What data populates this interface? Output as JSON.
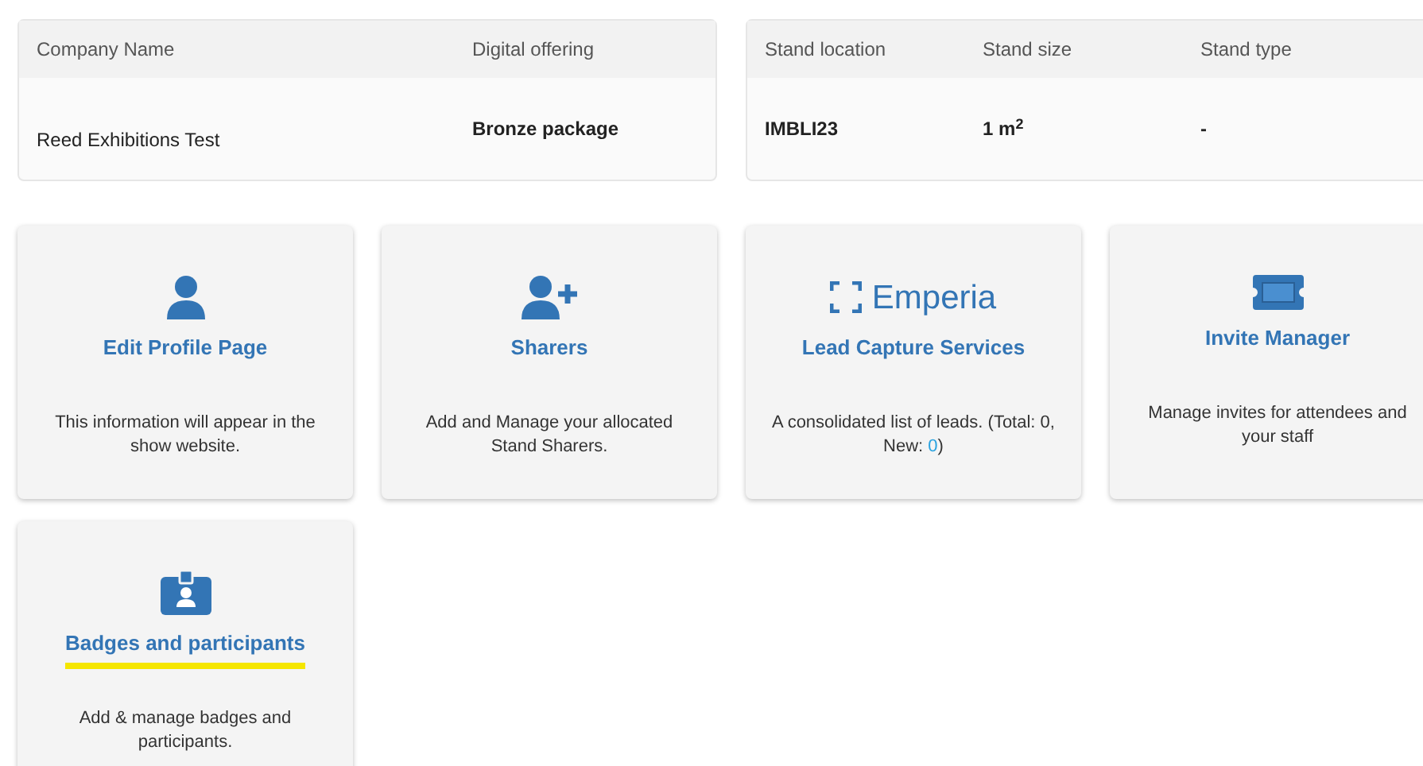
{
  "info_panels": [
    {
      "columns": [
        {
          "header": "Company Name",
          "value": "Reed Exhibitions Test",
          "bold": false
        },
        {
          "header": "Digital offering",
          "value": "Bronze package",
          "bold": true
        }
      ]
    },
    {
      "columns": [
        {
          "header": "Stand location",
          "value": "IMBLI23",
          "bold": true
        },
        {
          "header": "Stand size",
          "value": "1 m$^{2}$",
          "bold": true
        },
        {
          "header": "Stand type",
          "value": "-",
          "bold": true
        }
      ]
    }
  ],
  "cards": [
    {
      "kind": "person",
      "title": "Edit Profile Page",
      "description": [
        {
          "text": "This information will appear in the show website.",
          "highlight": false
        }
      ],
      "underlined": false
    },
    {
      "kind": "person-plus",
      "title": "Sharers",
      "description": [
        {
          "text": "Add and Manage your allocated Stand Sharers.",
          "highlight": false
        }
      ],
      "underlined": false
    },
    {
      "kind": "logo",
      "logo_text": "Emperia",
      "title": "Lead Capture Services",
      "description": [
        {
          "text": "A consolidated list of leads. (Total: 0, New: ",
          "highlight": false
        },
        {
          "text": "0",
          "highlight": true
        },
        {
          "text": ")",
          "highlight": false
        }
      ],
      "underlined": false
    },
    {
      "kind": "ticket",
      "title": "Invite Manager",
      "description": [
        {
          "text": "Manage invites for attendees and your staff",
          "highlight": false
        }
      ],
      "underlined": false
    },
    {
      "kind": "badge",
      "title": "Badges and participants",
      "description": [
        {
          "text": "Add & manage badges and participants.",
          "highlight": false
        }
      ],
      "underlined": true
    }
  ]
}
